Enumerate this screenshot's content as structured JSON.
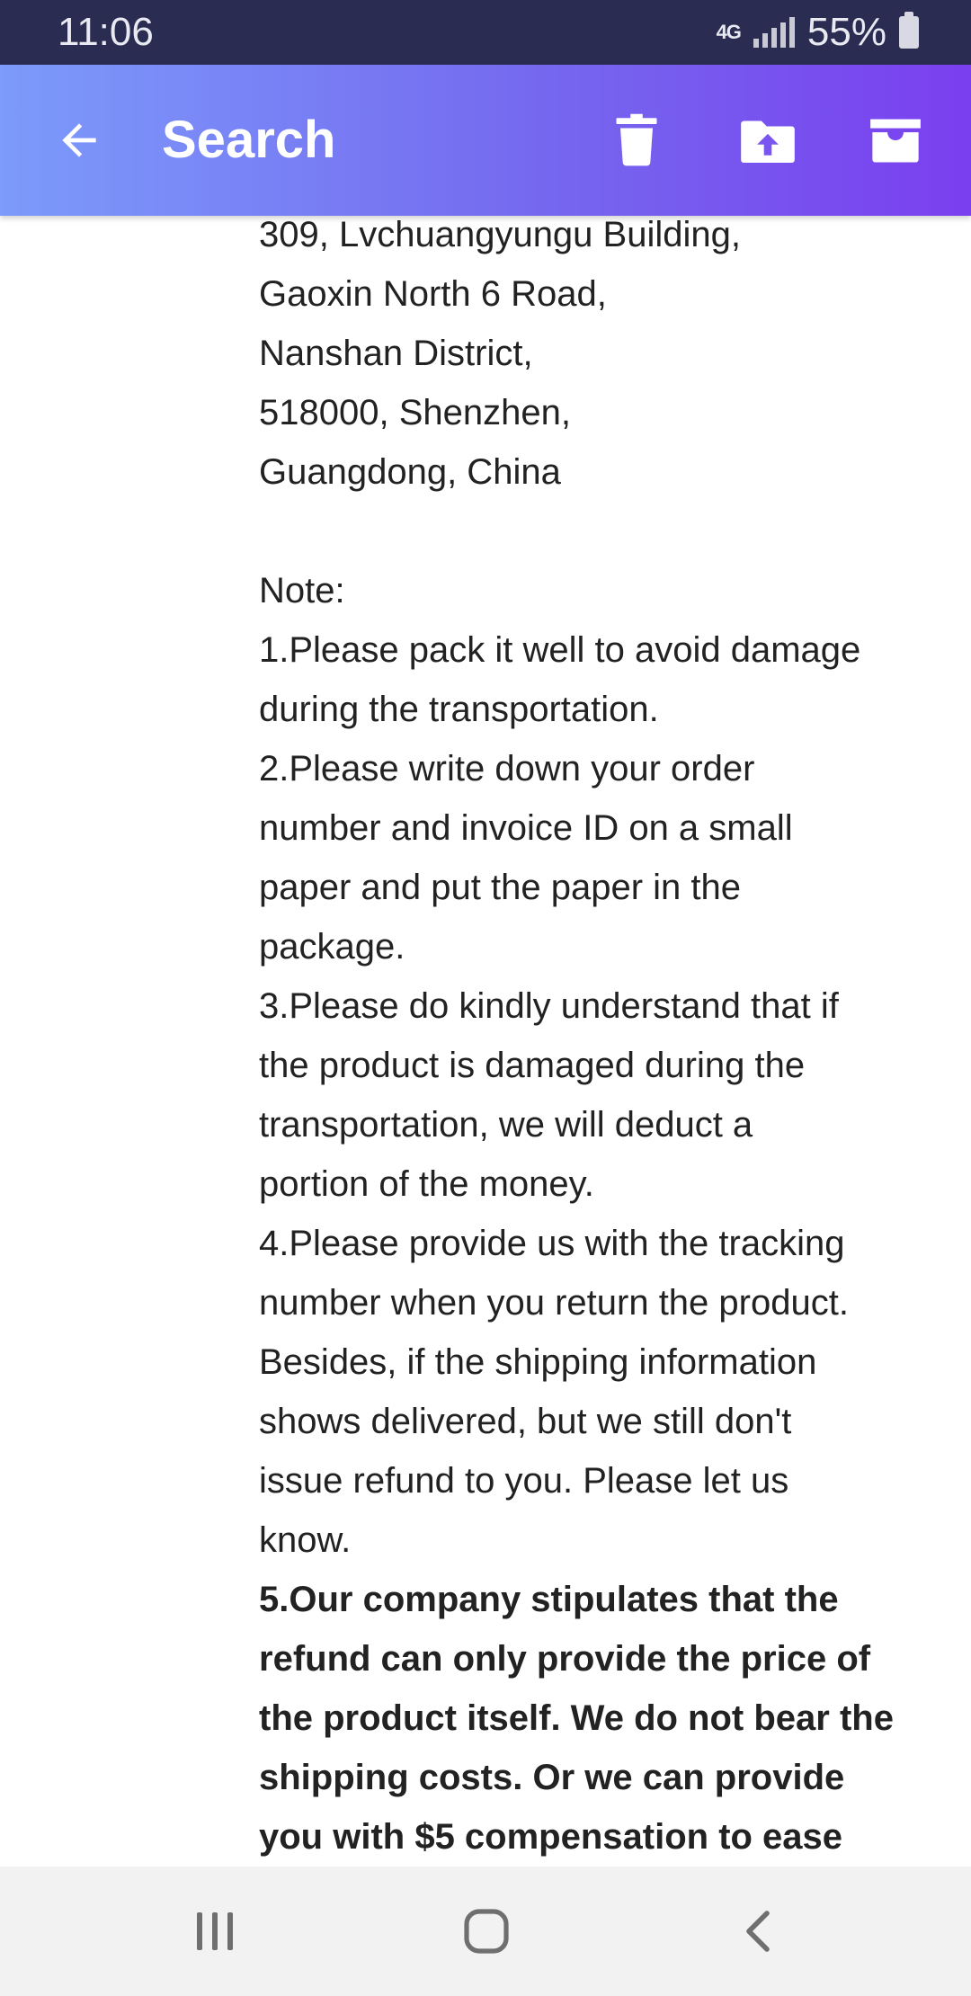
{
  "status_bar": {
    "time": "11:06",
    "network": "4G",
    "battery": "55%"
  },
  "app_bar": {
    "title": "Search",
    "icons": [
      "back-arrow-icon",
      "trash-icon",
      "move-to-folder-icon",
      "archive-icon"
    ]
  },
  "message": {
    "address_lines": [
      "309, Lvchuangyungu Building,",
      "Gaoxin North 6 Road,",
      "Nanshan District,",
      "518000, Shenzhen,",
      "Guangdong, China"
    ],
    "note_label": "Note:",
    "note_lines": [
      "1.Please pack it well to avoid damage",
      "during the transportation.",
      "2.Please write down your order",
      "number and invoice ID on a small",
      "paper and put the paper in the",
      "package.",
      "3.Please do kindly understand that if",
      "the product is damaged during the",
      "transportation, we will deduct a",
      "portion of the money.",
      "4.Please provide us with the tracking",
      "number when you return the product.",
      "Besides, if the shipping information",
      "shows delivered, but we still don't",
      "issue refund to you. Please let us",
      "know."
    ],
    "bold_lines": [
      "5.Our company stipulates that the",
      "refund can only provide the price of",
      "the product itself. We do not bear the",
      "shipping costs. Or we can provide",
      "you with $5 compensation to ease"
    ]
  },
  "nav_bar": {
    "icons": [
      "recent-apps-icon",
      "home-icon",
      "back-icon"
    ]
  },
  "colors": {
    "status_bar": "#2a2c52",
    "app_bar_start": "#7c9bfb",
    "app_bar_end": "#7a3fef",
    "text": "#222222",
    "nav_bar": "#f2f2f2"
  }
}
